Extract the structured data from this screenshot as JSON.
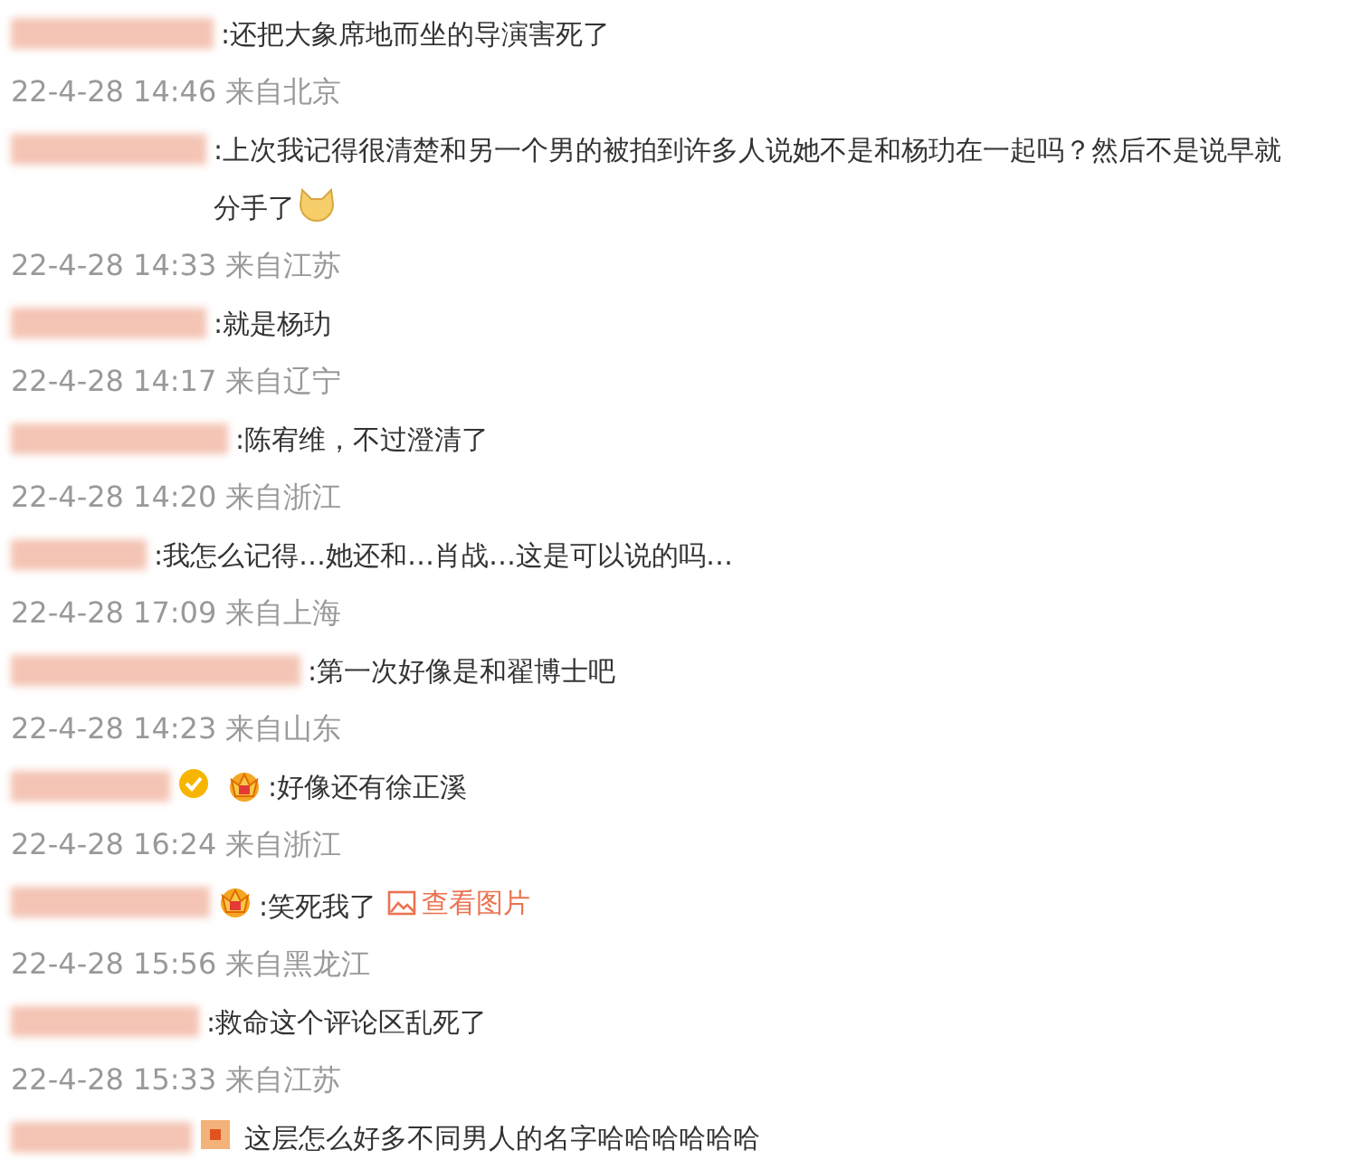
{
  "comments": [
    {
      "text": ":还把大象席地而坐的导演害死了",
      "time": "22-4-28 14:46 来自北京"
    },
    {
      "text": ":上次我记得很清楚和另一个男的被拍到许多人说她不是和杨玏在一起吗？然后不是说早就分手了",
      "emoji": true,
      "time": "22-4-28 14:33 来自江苏"
    },
    {
      "text": ":就是杨玏",
      "time": "22-4-28 14:17 来自辽宁"
    },
    {
      "text": ":陈宥维，不过澄清了",
      "time": "22-4-28 14:20 来自浙江"
    },
    {
      "text": ":我怎么记得…她还和…肖战…这是可以说的吗…",
      "time": "22-4-28 17:09 来自上海"
    },
    {
      "text": ":第一次好像是和翟博士吧",
      "time": "22-4-28 14:23 来自山东"
    },
    {
      "badges": [
        {
          "kind": "verified"
        },
        {
          "kind": "crown"
        }
      ],
      "text": ":好像还有徐正溪",
      "time": "22-4-28 16:24 来自浙江"
    },
    {
      "badges": [
        {
          "kind": "crown"
        }
      ],
      "text": ":笑死我了",
      "link": "查看图片",
      "time": "22-4-28 15:56 来自黑龙江"
    },
    {
      "text": ":救命这个评论区乱死了",
      "time": "22-4-28 15:33 来自江苏"
    },
    {
      "badges": [
        {
          "kind": "member"
        }
      ],
      "text": " 这层怎么好多不同男人的名字哈哈哈哈哈哈"
    }
  ]
}
